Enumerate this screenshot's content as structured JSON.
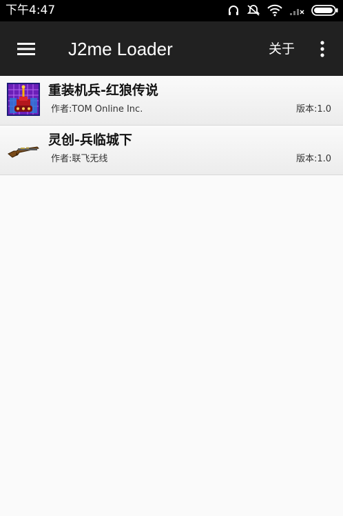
{
  "status_bar": {
    "time": "下午4:47",
    "icons": [
      "headphones-icon",
      "mute-vibrate-icon",
      "wifi-icon",
      "no-signal-icon",
      "battery-icon"
    ]
  },
  "toolbar": {
    "title": "J2me Loader",
    "about_label": "关于",
    "menu_icon": "hamburger-menu-icon",
    "overflow_icon": "more-vertical-icon"
  },
  "apps": [
    {
      "name": "重装机兵-红狼传说",
      "author": "作者:TOM Online Inc.",
      "version": "版本:1.0",
      "icon": "game-tank-icon"
    },
    {
      "name": "灵创-兵临城下",
      "author": "作者:联飞无线",
      "version": "版本:1.0",
      "icon": "game-rifle-icon"
    }
  ]
}
